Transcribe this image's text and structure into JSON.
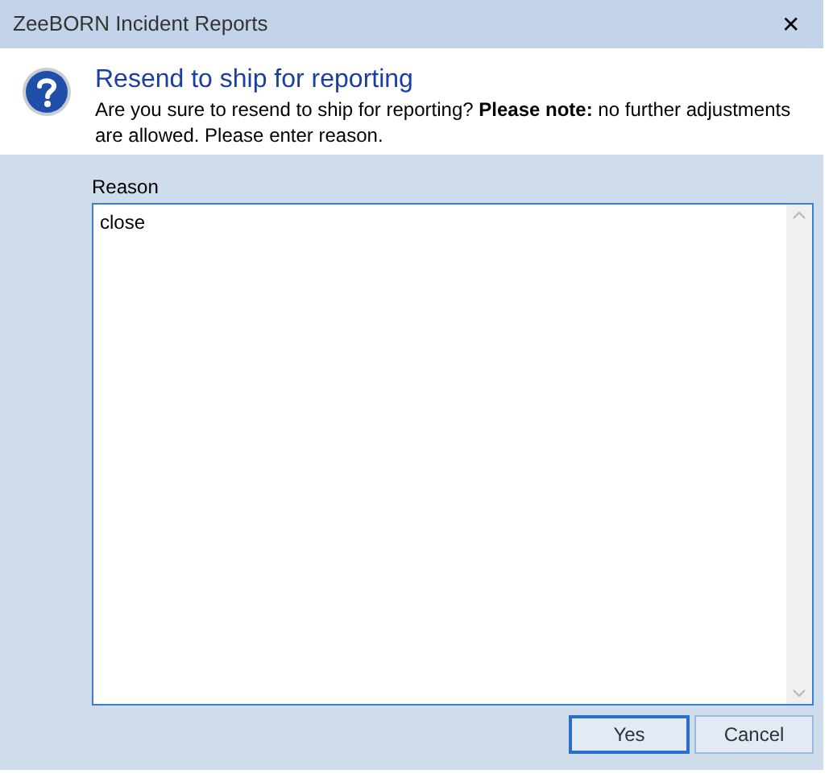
{
  "window": {
    "title": "ZeeBORN Incident Reports",
    "close_glyph": "✕"
  },
  "header": {
    "title": "Resend to ship for reporting",
    "message": "Are you sure to resend to ship for reporting? **Please note:** no further adjustments are allowed. Please enter reason."
  },
  "reason": {
    "label": "Reason",
    "value": "close"
  },
  "buttons": [
    {
      "label": "Yes",
      "default": true
    },
    {
      "label": "Cancel",
      "default": false
    }
  ]
}
